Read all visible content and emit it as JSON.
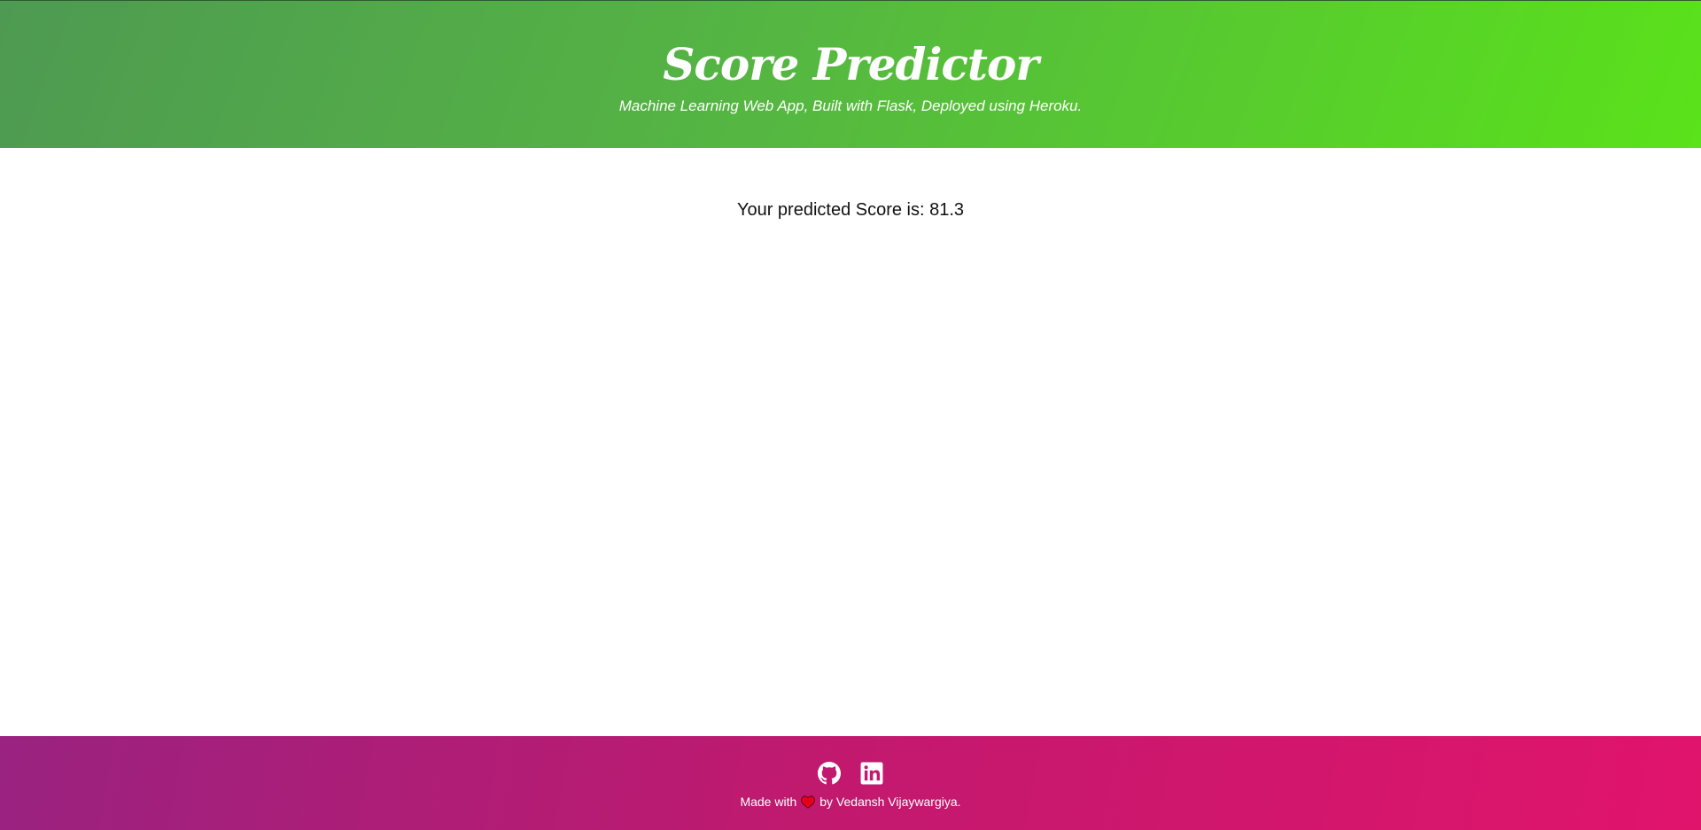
{
  "header": {
    "title": "Score Predictor",
    "subtitle": "Machine Learning Web App, Built with Flask, Deployed using Heroku."
  },
  "main": {
    "result_text": "Your predicted Score is: 81.3"
  },
  "footer": {
    "social_icons": [
      "github-icon",
      "linkedin-icon"
    ],
    "credit_prefix": "Made with",
    "credit_icon": "heart-icon",
    "credit_suffix": "by Vedansh Vijaywargiya."
  },
  "colors": {
    "header_gradient_start": "#4e9a52",
    "header_gradient_end": "#5ae21a",
    "footer_gradient_start": "#9a2280",
    "footer_gradient_end": "#e1146c",
    "heart": "#e3001b"
  }
}
